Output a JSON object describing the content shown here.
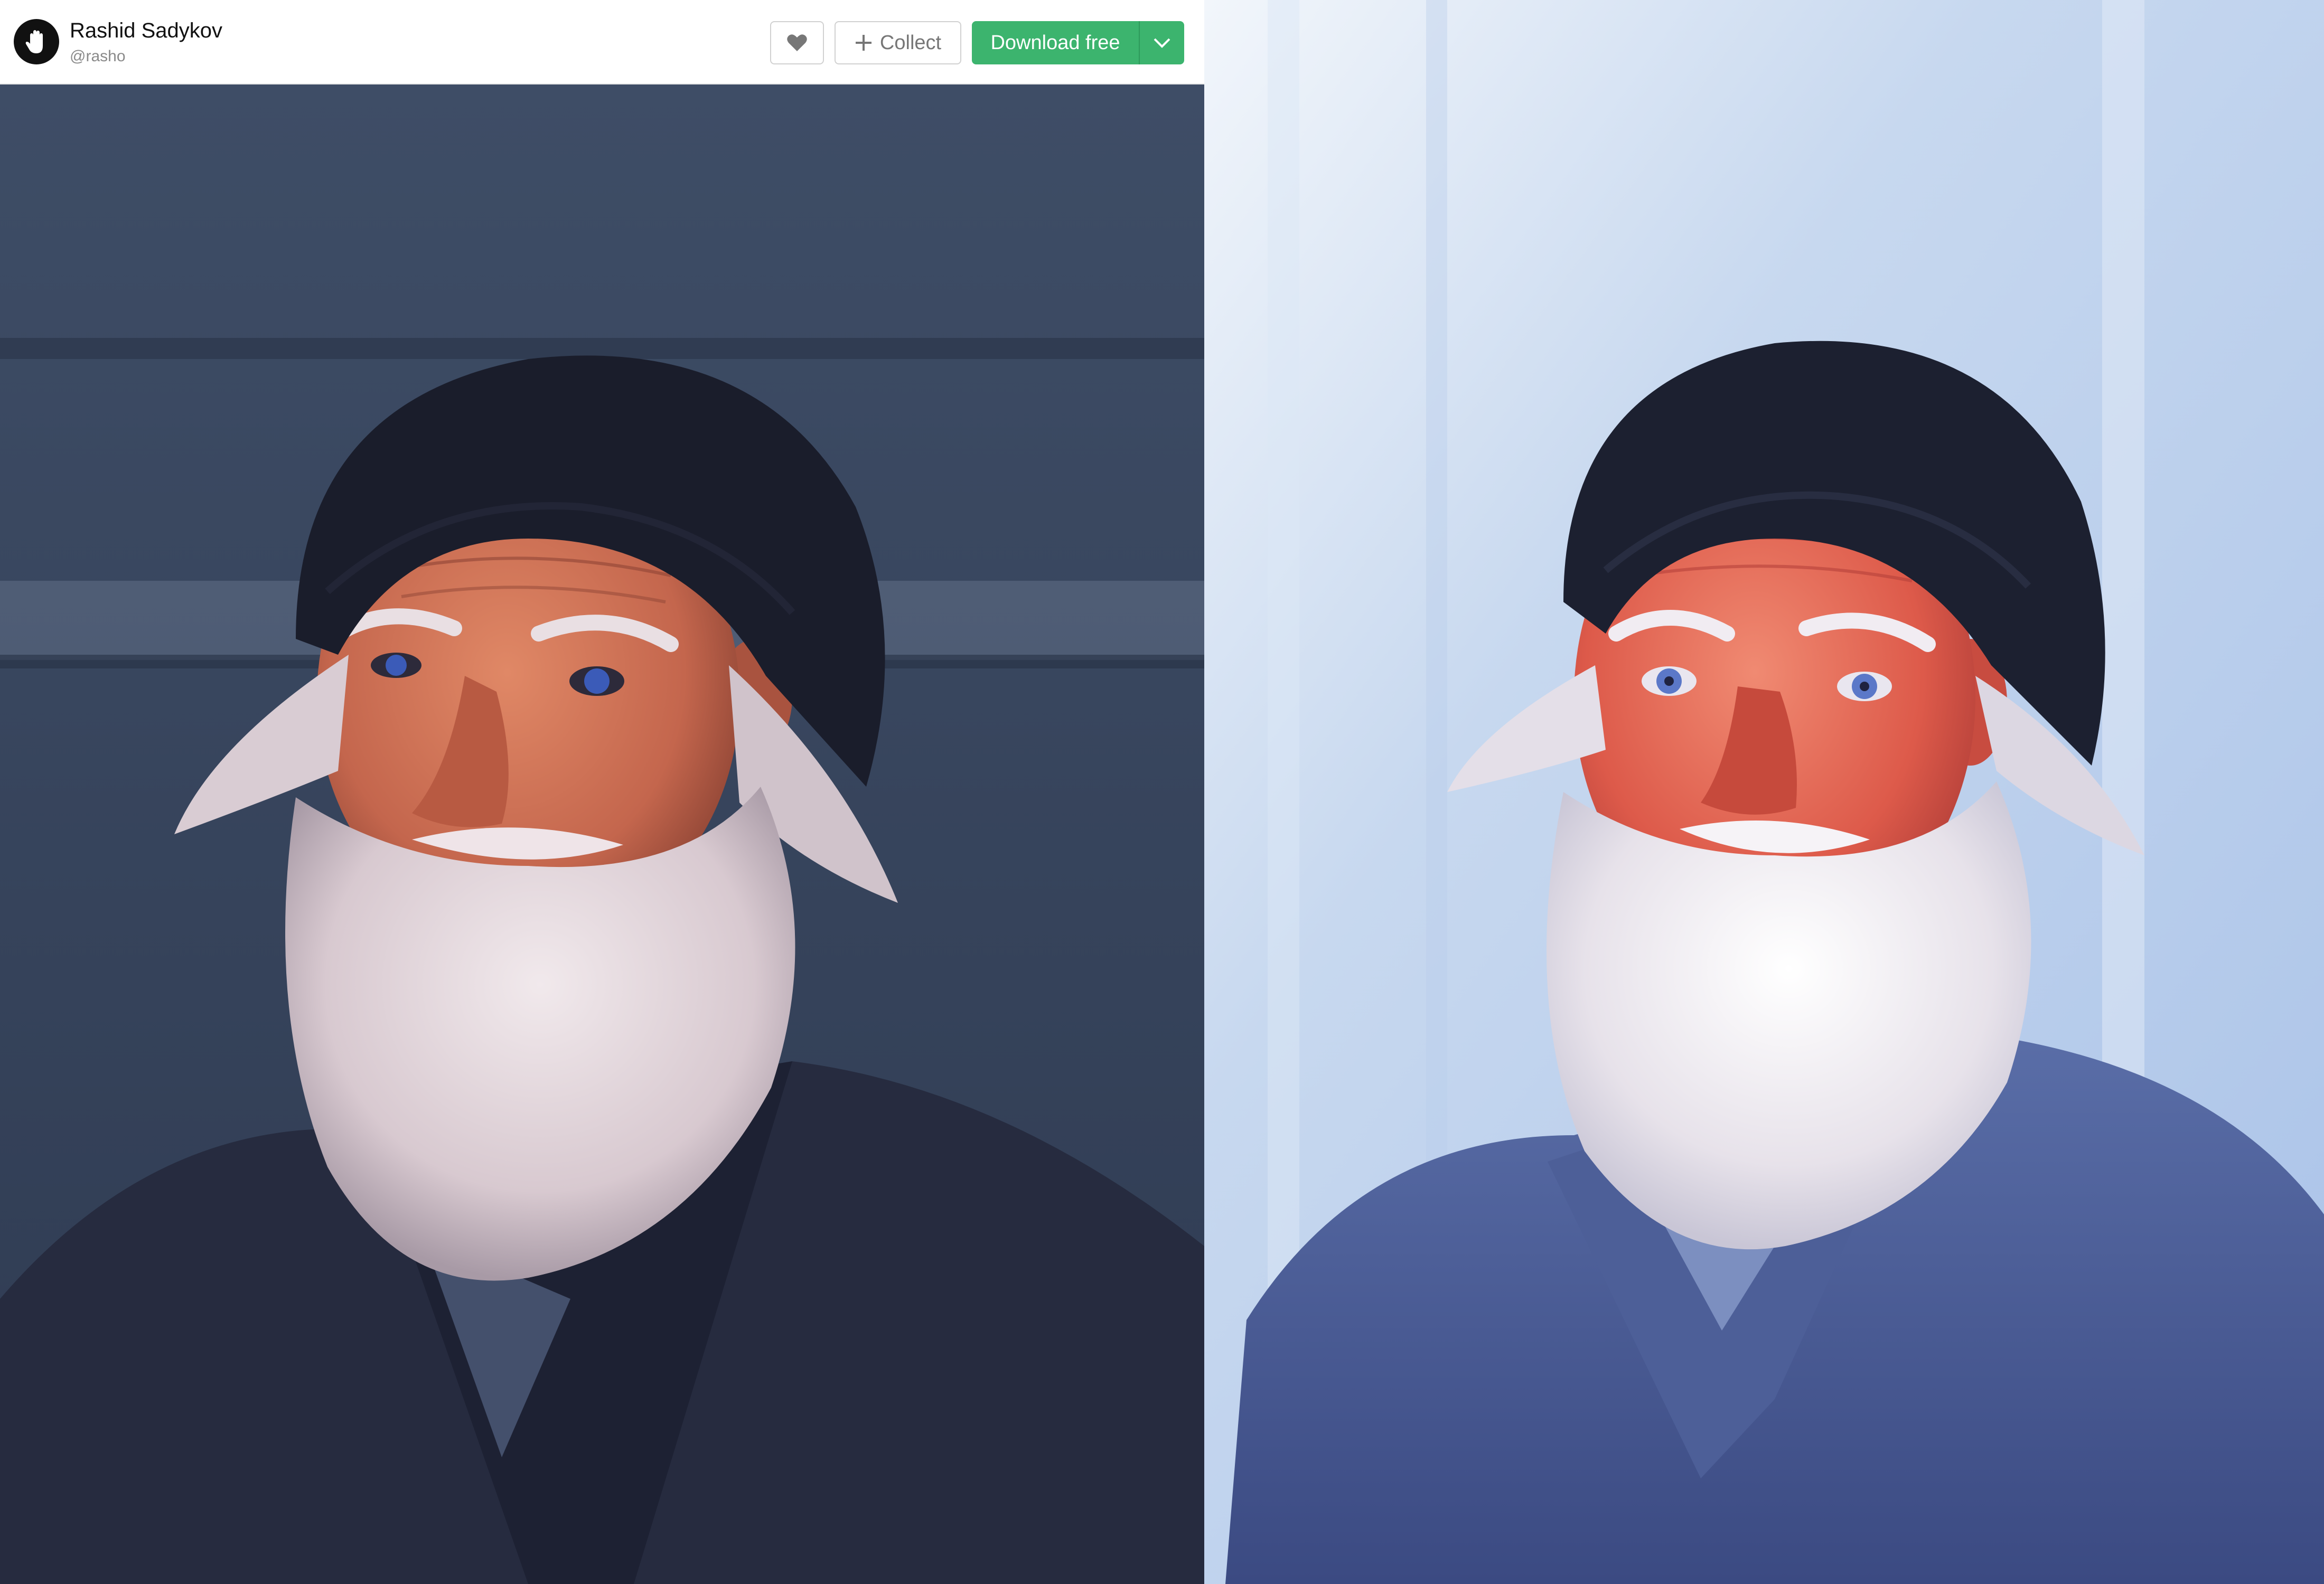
{
  "author": {
    "name": "Rashid Sadykov",
    "handle": "@rasho",
    "avatar_icon": "hand-icon"
  },
  "toolbar": {
    "like_icon": "heart-icon",
    "collect_label": "Collect",
    "collect_icon": "plus-icon",
    "download_label": "Download free",
    "download_menu_icon": "chevron-down-icon",
    "download_color": "#3cb46e"
  },
  "images": {
    "left": "photograph-portrait",
    "right": "painted-portrait"
  }
}
